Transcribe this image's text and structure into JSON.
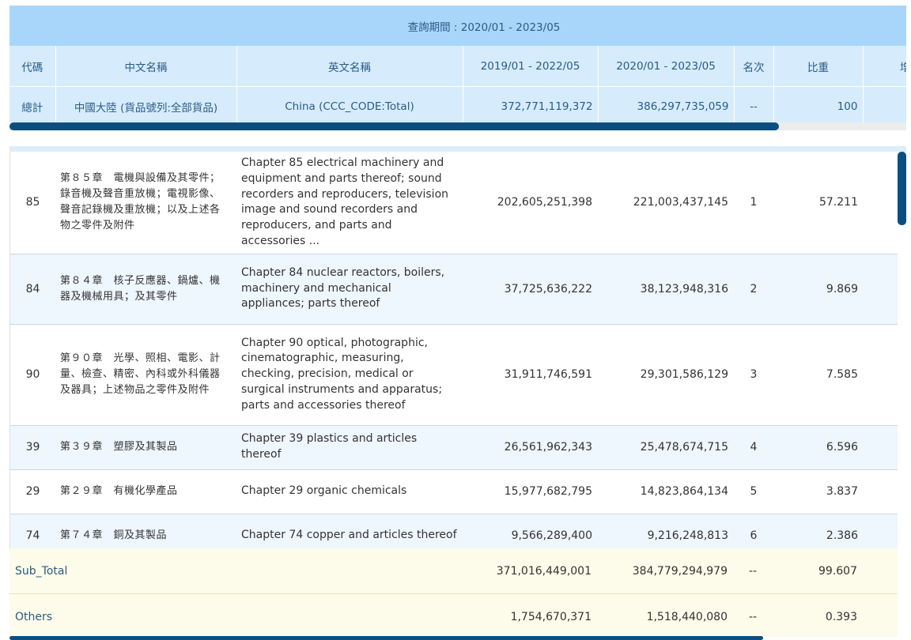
{
  "header": {
    "period_label": "查詢期間 : 2020/01 - 2023/05",
    "columns": [
      "代碼",
      "中文名稱",
      "英文名稱",
      "2019/01 - 2022/05",
      "2020/01 - 2023/05",
      "名次",
      "比重",
      "增減"
    ]
  },
  "total": {
    "label": "總計",
    "zh": "中國大陸 (貨品號列:全部貨品)",
    "en": "China (CCC_CODE:Total)",
    "v1": "372,771,119,372",
    "v2": "386,297,735,059",
    "rank": "--",
    "share": "100"
  },
  "rows": [
    {
      "code": "85",
      "zh": "第８５章　電機與設備及其零件；錄音機及聲音重放機；電視影像、聲音記錄機及重放機；以及上述各物之零件及附件",
      "en": "Chapter 85 electrical machinery and equipment and parts thereof; sound recorders and reproducers, television image and sound recorders and reproducers, and parts and accessories ...",
      "v1": "202,605,251,398",
      "v2": "221,003,437,145",
      "rank": "1",
      "share": "57.211"
    },
    {
      "code": "84",
      "zh": "第８４章　核子反應器、鍋爐、機器及機械用具；及其零件",
      "en": "Chapter 84 nuclear reactors, boilers, machinery and mechanical appliances; parts thereof",
      "v1": "37,725,636,222",
      "v2": "38,123,948,316",
      "rank": "2",
      "share": "9.869"
    },
    {
      "code": "90",
      "zh": "第９０章　光學、照相、電影、計量、檢查、精密、內科或外科儀器及器具；上述物品之零件及附件",
      "en": "Chapter 90 optical, photographic, cinematographic, measuring, checking, precision, medical or surgical instruments and apparatus; parts and accessories thereof",
      "v1": "31,911,746,591",
      "v2": "29,301,586,129",
      "rank": "3",
      "share": "7.585"
    },
    {
      "code": "39",
      "zh": "第３９章　塑膠及其製品",
      "en": "Chapter 39 plastics and articles thereof",
      "v1": "26,561,962,343",
      "v2": "25,478,674,715",
      "rank": "4",
      "share": "6.596"
    },
    {
      "code": "29",
      "zh": "第２９章　有機化學產品",
      "en": "Chapter 29 organic chemicals",
      "v1": "15,977,682,795",
      "v2": "14,823,864,134",
      "rank": "5",
      "share": "3.837"
    },
    {
      "code": "74",
      "zh": "第７４章　銅及其製品",
      "en": "Chapter 74 copper and articles thereof",
      "v1": "9,566,289,400",
      "v2": "9,216,248,813",
      "rank": "6",
      "share": "2.386"
    }
  ],
  "footer": [
    {
      "label": "Sub_Total",
      "v1": "371,016,449,001",
      "v2": "384,779,294,979",
      "rank": "--",
      "share": "99.607"
    },
    {
      "label": "Others",
      "v1": "1,754,670,371",
      "v2": "1,518,440,080",
      "rank": "--",
      "share": "0.393"
    }
  ]
}
